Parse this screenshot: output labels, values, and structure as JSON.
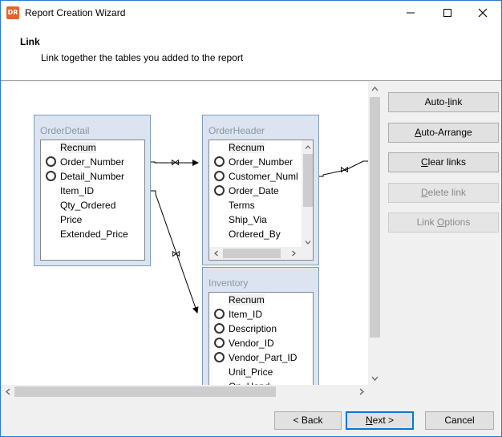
{
  "window": {
    "title": "Report Creation Wizard",
    "app_icon_text": "DR"
  },
  "header": {
    "title": "Link",
    "subtitle": "Link together the tables you added to the report"
  },
  "tables": {
    "order_detail": {
      "title": "OrderDetail",
      "fields": [
        {
          "name": "Recnum",
          "key": false,
          "selected": true
        },
        {
          "name": "Order_Number",
          "key": true,
          "selected": false
        },
        {
          "name": "Detail_Number",
          "key": true,
          "selected": false
        },
        {
          "name": "Item_ID",
          "key": false,
          "selected": false
        },
        {
          "name": "Qty_Ordered",
          "key": false,
          "selected": false
        },
        {
          "name": "Price",
          "key": false,
          "selected": false
        },
        {
          "name": "Extended_Price",
          "key": false,
          "selected": false
        }
      ]
    },
    "order_header": {
      "title": "OrderHeader",
      "fields": [
        {
          "name": "Recnum",
          "key": false,
          "selected": true
        },
        {
          "name": "Order_Number",
          "key": true,
          "selected": false
        },
        {
          "name": "Customer_Numl",
          "key": true,
          "selected": false
        },
        {
          "name": "Order_Date",
          "key": true,
          "selected": false
        },
        {
          "name": "Terms",
          "key": false,
          "selected": false
        },
        {
          "name": "Ship_Via",
          "key": false,
          "selected": false
        },
        {
          "name": "Ordered_By",
          "key": false,
          "selected": false
        }
      ]
    },
    "inventory": {
      "title": "Inventory",
      "fields": [
        {
          "name": "Recnum",
          "key": false,
          "selected": true
        },
        {
          "name": "Item_ID",
          "key": true,
          "selected": false
        },
        {
          "name": "Description",
          "key": true,
          "selected": false
        },
        {
          "name": "Vendor_ID",
          "key": true,
          "selected": false
        },
        {
          "name": "Vendor_Part_ID",
          "key": true,
          "selected": false
        },
        {
          "name": "Unit_Price",
          "key": false,
          "selected": false
        },
        {
          "name": "On_Hand",
          "key": false,
          "selected": false
        }
      ]
    }
  },
  "side_buttons": {
    "auto_link": {
      "pre": "Auto-",
      "u": "l",
      "post": "ink"
    },
    "auto_arrange": {
      "pre": "",
      "u": "A",
      "post": "uto-Arrange"
    },
    "clear_links": {
      "pre": "",
      "u": "C",
      "post": "lear links"
    },
    "delete_link": {
      "pre": "",
      "u": "D",
      "post": "elete link"
    },
    "link_options": {
      "pre": "Link ",
      "u": "O",
      "post": "ptions"
    }
  },
  "footer": {
    "back": "< Back",
    "next": {
      "u": "N",
      "post": "ext >"
    },
    "cancel": "Cancel"
  },
  "colors": {
    "accent": "#0078d7",
    "table_bg": "#dbe4f0",
    "app_icon": "#e8622b"
  }
}
